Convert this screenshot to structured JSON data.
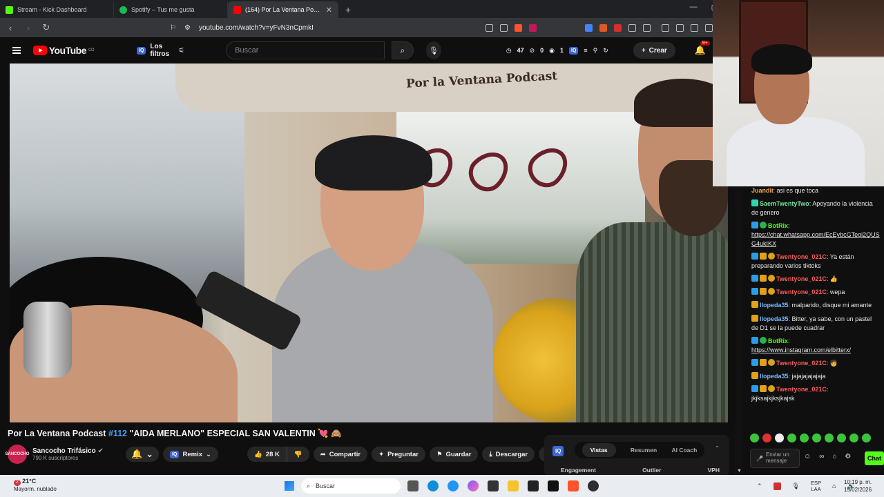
{
  "browser": {
    "tabs": [
      {
        "label": "Stream - Kick Dashboard",
        "color": "#53fc18",
        "active": false
      },
      {
        "label": "Spotify – Tus me gusta",
        "color": "#1db954",
        "active": false
      },
      {
        "label": "(164) Por La Ventana Podcast #1",
        "color": "#ff0000",
        "active": true
      }
    ],
    "new_tab": "+",
    "url": "youtube.com/watch?v=yFvN3nCpmkI"
  },
  "youtube": {
    "logo_text": "YouTube",
    "logo_country": "CO",
    "filters_label": "Los filtros",
    "iq_badge": "IQ",
    "search_placeholder": "Buscar",
    "stats": {
      "a": "47",
      "b": "0",
      "c": "1"
    },
    "create_label": "Crear",
    "notif_count": "9+"
  },
  "video": {
    "banner_text": "Por la Ventana Podcast",
    "title_prefix": "Por La Ventana Podcast ",
    "title_tag": "#112",
    "title_rest": " \"AIDA MERLANO\" ESPECIAL SAN VALENTIN 💘 🙈",
    "channel_name": "Sancocho Trifásico",
    "channel_subs": "790 K suscriptores",
    "channel_avatar_text": "SANCOCHO",
    "actions": {
      "remix": "Remix",
      "likes": "28 K",
      "share": "Compartir",
      "ask": "Preguntar",
      "save": "Guardar",
      "download": "Descargar",
      "more": "•••"
    }
  },
  "iq_panel": {
    "badge": "IQ",
    "tabs": [
      "Vistas",
      "Resumen",
      "AI Coach"
    ],
    "columns": [
      "Engagement",
      "Outlier",
      "VPH"
    ]
  },
  "chat": {
    "messages": [
      {
        "badges": [],
        "user": "Juandii",
        "color": "#f1a94e",
        "text": ": asi es que toca"
      },
      {
        "badges": [
          "cyan"
        ],
        "user": "SaemTwentyTwo",
        "color": "#6ee7a0",
        "text": ": Apoyando la violencia de genero"
      },
      {
        "badges": [
          "blue",
          "green"
        ],
        "user": "BotRix",
        "color": "#53fc18",
        "text": ":",
        "link": "https://chat.whatsapp.com/EcEybcGTegj2QUSG4ukIKX"
      },
      {
        "badges": [
          "blue",
          "crown",
          "coin"
        ],
        "user": "Twentyone_021C",
        "color": "#ff5a5a",
        "text": ": Ya están preparando varios tiktoks"
      },
      {
        "badges": [
          "blue",
          "crown",
          "coin"
        ],
        "user": "Twentyone_021C",
        "color": "#ff5a5a",
        "text": ": 👍"
      },
      {
        "badges": [
          "blue",
          "crown",
          "coin"
        ],
        "user": "Twentyone_021C",
        "color": "#ff5a5a",
        "text": ": wepa"
      },
      {
        "badges": [
          "crown"
        ],
        "user": "llореda35",
        "color": "#7ab8ff",
        "text": ": malparido, disque mi amante"
      },
      {
        "badges": [
          "crown"
        ],
        "user": "llореda35",
        "color": "#7ab8ff",
        "text": ": Bitter, ya sabe, con un pastel de D1 se la puede cuadrar"
      },
      {
        "badges": [
          "blue",
          "green"
        ],
        "user": "BotRix",
        "color": "#53fc18",
        "text": ":",
        "link": "https://www.instagram.com/elbitterx/"
      },
      {
        "badges": [
          "blue",
          "crown",
          "coin"
        ],
        "user": "Twentyone_021C",
        "color": "#ff5a5a",
        "text": ": 🧑"
      },
      {
        "badges": [
          "crown"
        ],
        "user": "llореda35",
        "color": "#7ab8ff",
        "text": ": jajajajajajaja"
      },
      {
        "badges": [
          "blue",
          "crown",
          "coin"
        ],
        "user": "Twentyone_021C",
        "color": "#ff5a5a",
        "text": ":",
        "after": "jkjksajkjksjkajsk"
      }
    ],
    "input_placeholder": "Enviar un mensaje",
    "send_label": "Chat"
  },
  "taskbar": {
    "weather_temp": "21°C",
    "weather_desc": "Mayorm. nublado",
    "weather_badge": "2",
    "search_label": "Buscar",
    "lang_top": "ESP",
    "lang_bottom": "LAA",
    "time": "10:19 p. m.",
    "date": "15/02/2026"
  }
}
